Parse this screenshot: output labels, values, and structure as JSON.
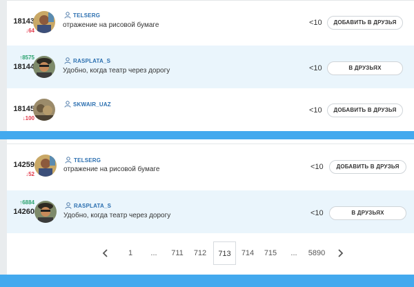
{
  "panel1": {
    "rows": [
      {
        "rank": "18143",
        "delta": "64",
        "delta_dir": "down",
        "username": "TELSERG",
        "status": "отражение на рисовой бумаге",
        "count": "<10",
        "button": "ДОБАВИТЬ В ДРУЗЬЯ"
      },
      {
        "rank": "18144",
        "delta": "8575",
        "delta_dir": "up",
        "username": "RASPLATA_S",
        "status": "Удобно, когда театр через дорогу",
        "count": "<10",
        "button": "В ДРУЗЬЯХ"
      },
      {
        "rank": "18145",
        "delta": "100",
        "delta_dir": "down",
        "username": "SKWAIR_UAZ",
        "status": "",
        "count": "<10",
        "button": "ДОБАВИТЬ В ДРУЗЬЯ"
      }
    ]
  },
  "panel2": {
    "rows": [
      {
        "rank": "14259",
        "delta": "52",
        "delta_dir": "down",
        "username": "TELSERG",
        "status": "отражение на рисовой бумаге",
        "count": "<10",
        "button": "ДОБАВИТЬ В ДРУЗЬЯ"
      },
      {
        "rank": "14260",
        "delta": "6884",
        "delta_dir": "up",
        "username": "RASPLATA_S",
        "status": "Удобно, когда театр через дорогу",
        "count": "<10",
        "button": "В ДРУЗЬЯХ"
      }
    ]
  },
  "pagination": {
    "pages": [
      "1",
      "...",
      "711",
      "712",
      "713",
      "714",
      "715",
      "...",
      "5890"
    ],
    "current": "713",
    "prev_icon": "chevron-left-icon",
    "next_icon": "chevron-right-icon"
  },
  "colors": {
    "accent_bar": "#43a9ee",
    "alt_row": "#eaf5fc",
    "up": "#2aa26e",
    "down": "#e2394a",
    "username": "#2b6fb0"
  },
  "icons": {
    "user": "user-icon",
    "delta_up": "arrow-up-icon",
    "delta_down": "arrow-down-icon"
  }
}
